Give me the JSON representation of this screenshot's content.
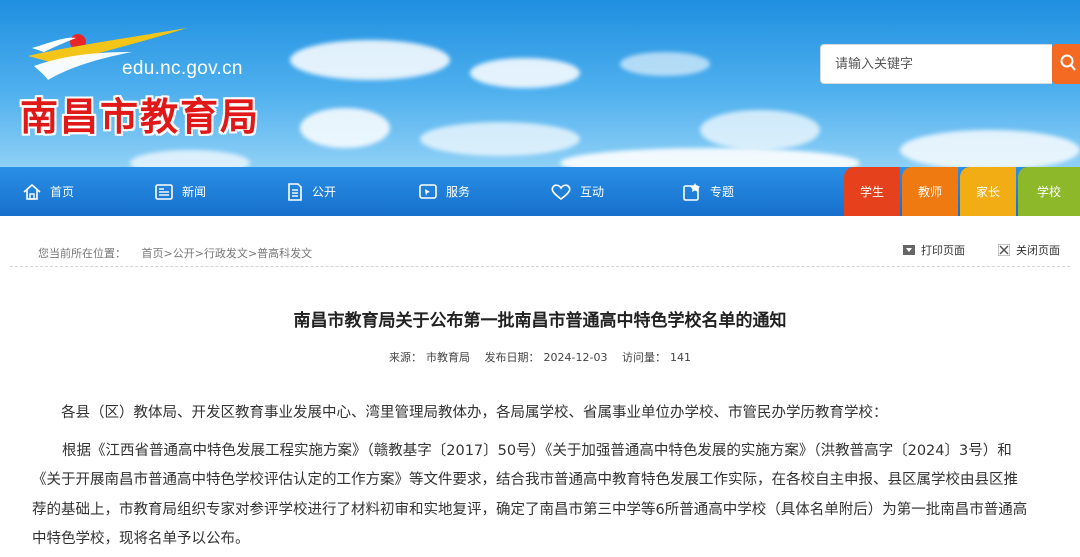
{
  "site": {
    "domain": "edu.nc.gov.cn",
    "name": "南昌市教育局"
  },
  "search": {
    "placeholder": "请输入关键字"
  },
  "nav": {
    "items": [
      {
        "label": "首页",
        "icon": "home-icon"
      },
      {
        "label": "新闻",
        "icon": "news-icon"
      },
      {
        "label": "公开",
        "icon": "document-icon"
      },
      {
        "label": "服务",
        "icon": "service-icon"
      },
      {
        "label": "互动",
        "icon": "heart-icon"
      },
      {
        "label": "专题",
        "icon": "topic-icon"
      }
    ],
    "roles": [
      {
        "label": "学生",
        "color": "#e5411c"
      },
      {
        "label": "教师",
        "color": "#f07a12"
      },
      {
        "label": "家长",
        "color": "#f2ad14"
      },
      {
        "label": "学校",
        "color": "#8cb82a"
      }
    ]
  },
  "breadcrumb": {
    "prefix": "您当前所在位置：",
    "items": [
      "首页",
      "公开",
      "行政发文",
      "普高科发文"
    ],
    "sep": ">"
  },
  "tools": {
    "print": "打印页面",
    "close": "关闭页面"
  },
  "article": {
    "title": "南昌市教育局关于公布第一批南昌市普通高中特色学校名单的通知",
    "source_label": "来源：",
    "source": "市教育局",
    "date_label": "发布日期：",
    "date": "2024-12-03",
    "views_label": "访问量：",
    "views": "141",
    "p1": "各县（区）教体局、开发区教育事业发展中心、湾里管理局教体办，各局属学校、省属事业单位办学校、市管民办学历教育学校：",
    "p2_line1": "根据《江西省普通高中特色发展工程实施方案》（赣教基字〔2017〕50号）《关于加强普通高中特色发展的实施方案》（洪教普高字〔2024〕3号）和",
    "p2_line2": "《关于开展南昌市普通高中特色学校评估认定的工作方案》等文件要求，结合我市普通高中教育特色发展工作实际，在各校自主申报、县区属学校由县区推",
    "p2_line3": "荐的基础上，市教育局组织专家对参评学校进行了材料初审和实地复评，确定了南昌市第三中学等6所普通高中学校（具体名单附后）为第一批南昌市普通高",
    "p2_line4": "中特色学校，现将名单予以公布。"
  }
}
